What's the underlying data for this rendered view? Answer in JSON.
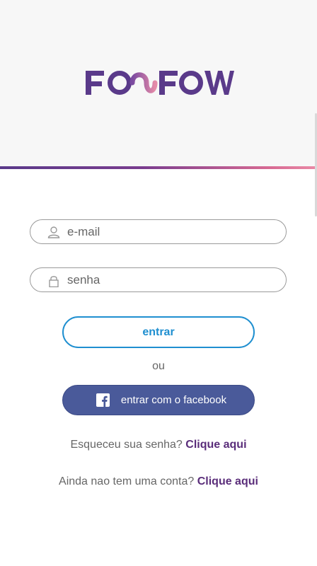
{
  "brand": {
    "logo_text": "FOOFOW"
  },
  "colors": {
    "brand_purple": "#5a3a8a",
    "brand_pink": "#e07a9c",
    "primary_blue": "#1f8fd0",
    "facebook_blue": "#4a5a9a",
    "link_purple": "#5a2d7a"
  },
  "form": {
    "email_placeholder": "e-mail",
    "password_placeholder": "senha",
    "email_icon": "user-icon",
    "password_icon": "lock-icon"
  },
  "actions": {
    "login_label": "entrar",
    "or_label": "ou",
    "facebook_label": "entrar com o facebook",
    "facebook_icon": "facebook-icon"
  },
  "links": {
    "forgot_text": "Esqueceu sua senha?",
    "forgot_link": "Clique aqui",
    "signup_text": "Ainda nao tem uma conta?",
    "signup_link": "Clique aqui"
  }
}
